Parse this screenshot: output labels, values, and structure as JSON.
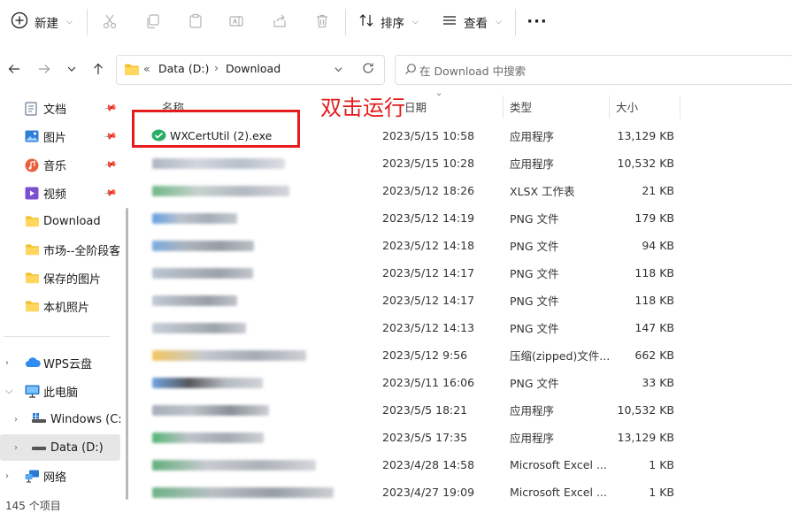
{
  "toolbar": {
    "new_label": "新建",
    "sort_label": "排序",
    "view_label": "查看"
  },
  "nav": {
    "address_prefix": "«",
    "crumb1": "Data (D:)",
    "crumb_sep": "›",
    "crumb2": "Download",
    "search_placeholder": "在 Download 中搜索"
  },
  "sidebar": {
    "quick": [
      {
        "label": "文档"
      },
      {
        "label": "图片"
      },
      {
        "label": "音乐"
      },
      {
        "label": "视频"
      },
      {
        "label": "Download"
      },
      {
        "label": "市场--全阶段客户"
      },
      {
        "label": "保存的图片"
      },
      {
        "label": "本机照片"
      }
    ],
    "tree": [
      {
        "label": "WPS云盘"
      },
      {
        "label": "此电脑"
      },
      {
        "label": "Windows (C:)"
      },
      {
        "label": "Data (D:)"
      },
      {
        "label": "网络"
      }
    ]
  },
  "columns": {
    "name": "名称",
    "date": "修改日期",
    "type": "类型",
    "size": "大小"
  },
  "files": [
    {
      "name": "WXCertUtil (2).exe",
      "date": "2023/5/15 10:58",
      "type": "应用程序",
      "size": "13,129 KB"
    },
    {
      "name": "",
      "date": "2023/5/15 10:28",
      "type": "应用程序",
      "size": "10,532 KB"
    },
    {
      "name": "",
      "date": "2023/5/12 18:26",
      "type": "XLSX 工作表",
      "size": "21 KB"
    },
    {
      "name": "",
      "date": "2023/5/12 14:19",
      "type": "PNG 文件",
      "size": "179 KB"
    },
    {
      "name": "",
      "date": "2023/5/12 14:18",
      "type": "PNG 文件",
      "size": "94 KB"
    },
    {
      "name": "",
      "date": "2023/5/12 14:17",
      "type": "PNG 文件",
      "size": "118 KB"
    },
    {
      "name": "",
      "date": "2023/5/12 14:17",
      "type": "PNG 文件",
      "size": "118 KB"
    },
    {
      "name": "",
      "date": "2023/5/12 14:13",
      "type": "PNG 文件",
      "size": "147 KB"
    },
    {
      "name": "",
      "date": "2023/5/12 9:56",
      "type": "压缩(zipped)文件...",
      "size": "662 KB"
    },
    {
      "name": "",
      "date": "2023/5/11 16:06",
      "type": "PNG 文件",
      "size": "33 KB"
    },
    {
      "name": "",
      "date": "2023/5/5 18:21",
      "type": "应用程序",
      "size": "10,532 KB"
    },
    {
      "name": "",
      "date": "2023/5/5 17:35",
      "type": "应用程序",
      "size": "13,129 KB"
    },
    {
      "name": "",
      "date": "2023/4/28 14:58",
      "type": "Microsoft Excel ...",
      "size": "1 KB"
    },
    {
      "name": "",
      "date": "2023/4/27 19:09",
      "type": "Microsoft Excel ...",
      "size": "1 KB"
    }
  ],
  "annotation": {
    "text": "双击运行"
  },
  "status": {
    "text": "145 个项目"
  },
  "colors": {
    "accent": "#0067c0",
    "annotation": "#e51c1c",
    "folder": "#f3c12f",
    "selected_bg": "#e6e6e6"
  },
  "icons": [
    "plus-icon",
    "scissors-icon",
    "copy-icon",
    "paste-icon",
    "rename-icon",
    "share-icon",
    "delete-icon",
    "sort-icon",
    "view-icon",
    "more-icon",
    "back-icon",
    "forward-icon",
    "recent-icon",
    "up-icon",
    "folder-icon",
    "refresh-icon",
    "search-icon",
    "wechat-icon"
  ]
}
